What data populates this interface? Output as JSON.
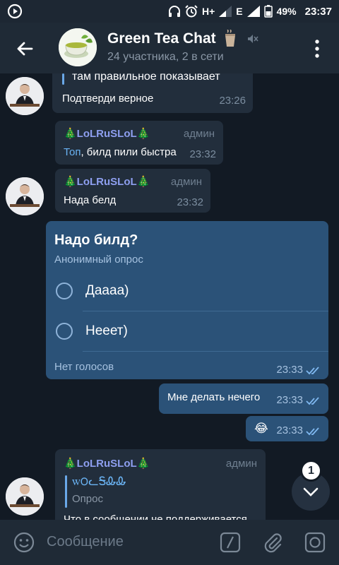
{
  "status_bar": {
    "network": "H+",
    "network2": "E",
    "battery": "49%",
    "time": "23:37"
  },
  "header": {
    "title": "Green Tea Chat",
    "subtitle": "24 участника, 2 в сети"
  },
  "messages": {
    "m1": {
      "quote": "там правильное показывает",
      "text": "Подтверди верное",
      "time": "23:26"
    },
    "m2": {
      "sender": "🎄LoLRuSLoL🎄",
      "role": "админ",
      "link": "Топ",
      "text": ", билд пили быстра",
      "time": "23:32"
    },
    "m3": {
      "sender": "🎄LoLRuSLoL🎄",
      "role": "админ",
      "text": "Нада белд",
      "time": "23:32"
    },
    "poll": {
      "question": "Надо билд?",
      "type": "Анонимный опрос",
      "options": [
        "Даааа)",
        "Нееет)"
      ],
      "votes": "Нет голосов",
      "time": "23:33"
    },
    "m5": {
      "text": "Мне делать нечего",
      "time": "23:33"
    },
    "m6": {
      "text": "😂",
      "time": "23:33"
    },
    "m7": {
      "sender": "🎄LoLRuSLoL🎄",
      "role": "админ",
      "quote_title": "ꮃ౦ᓚᎦᎲᎲ",
      "quote_text": "Опрос",
      "text": "Что в сообщении не поддерживается"
    }
  },
  "fab": {
    "badge": "1"
  },
  "input": {
    "placeholder": "Сообщение"
  },
  "colors": {
    "background": "#121a24",
    "header": "#1f2a36",
    "incoming_bubble": "#222e3c",
    "outgoing_bubble": "#2b5278",
    "sender_name": "#8e9ff0",
    "link": "#6ab3f3"
  }
}
